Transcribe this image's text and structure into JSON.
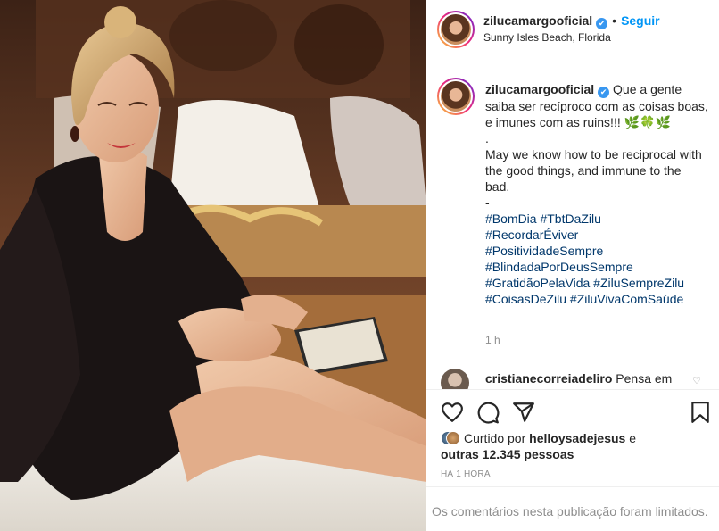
{
  "post": {
    "username": "zilucamargooficial",
    "verified_mark": "✔",
    "separator": "•",
    "follow_label": "Seguir",
    "location": "Sunny Isles Beach, Florida"
  },
  "caption": {
    "username": "zilucamargooficial",
    "text_pt": "Que a gente saiba ser recíproco com as coisas boas, e imunes com as ruins!!! 🌿🍀🌿",
    "dot": ".",
    "text_en": "May we know how to be reciprocal with the good things, and immune to the bad.",
    "dash": "-",
    "hashtags": [
      "#BomDia #TbtDaZilu",
      "#RecordarÉviver",
      "#PositividadeSempre",
      "#BlindadaPorDeusSempre",
      "#GratidãoPelaVida #ZiluSempreZilu",
      "#CoisasDeZilu #ZiluVivaComSaúde"
    ],
    "time": "1 h"
  },
  "comment": {
    "username": "cristianecorreiadeliro",
    "text": "Pensa em"
  },
  "icons": {
    "like": "heart-icon",
    "comment": "comment-icon",
    "share": "share-icon",
    "save": "bookmark-icon",
    "comment_like": "small-heart-icon"
  },
  "likes": {
    "prefix": "Curtido por",
    "user": "helloysadejesus",
    "conj": "e",
    "others": "outras 12.345 pessoas"
  },
  "posted_ago": "HÁ 1 HORA",
  "comments_limited": "Os comentários nesta publicação foram limitados.",
  "colors": {
    "link_blue": "#0095f6",
    "hashtag": "#00376b",
    "muted": "#8e8e8e",
    "text": "#262626"
  }
}
